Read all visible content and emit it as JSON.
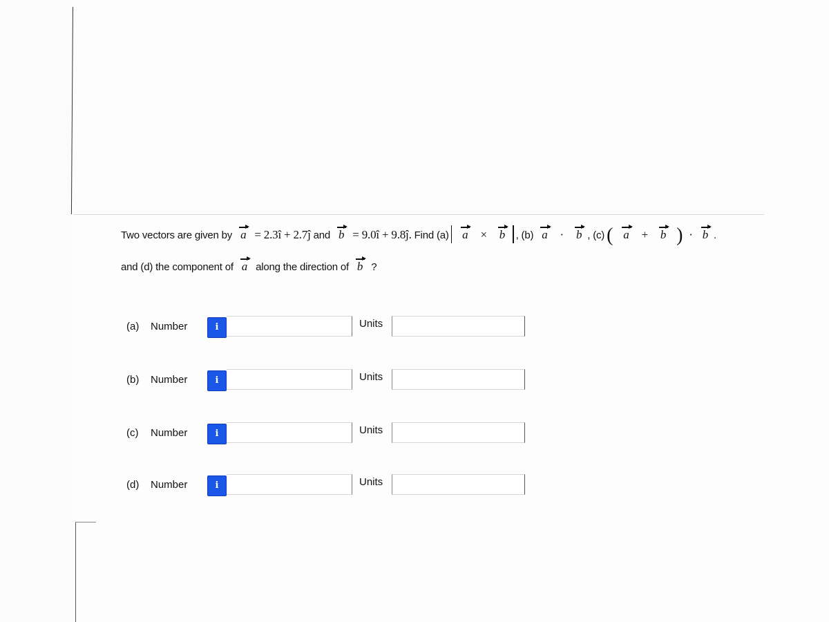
{
  "question": {
    "intro": "Two vectors are given by",
    "vector_a_symbol": "a",
    "vector_a_value": "= 2.3î + 2.7ĵ",
    "and": "and",
    "vector_b_symbol": "b",
    "vector_b_value": "= 9.0î + 9.8ĵ.",
    "find": "Find (a)",
    "cross": "×",
    "part_b_prefix": ", (b)",
    "dot": "·",
    "part_c_prefix": ", (c)",
    "plus": "+",
    "end_period": ".",
    "line2_prefix": "and (d) the component of",
    "line2_mid": "along the direction of",
    "line2_end": "?"
  },
  "answers": [
    {
      "part": "(a)",
      "number_label": "Number",
      "info_icon": "i",
      "number_value": "",
      "units_label": "Units",
      "units_value": ""
    },
    {
      "part": "(b)",
      "number_label": "Number",
      "info_icon": "i",
      "number_value": "",
      "units_label": "Units",
      "units_value": ""
    },
    {
      "part": "(c)",
      "number_label": "Number",
      "info_icon": "i",
      "number_value": "",
      "units_label": "Units",
      "units_value": ""
    },
    {
      "part": "(d)",
      "number_label": "Number",
      "info_icon": "i",
      "number_value": "",
      "units_label": "Units",
      "units_value": ""
    }
  ],
  "colors": {
    "info_button": "#1a56e8",
    "text": "#111111"
  }
}
